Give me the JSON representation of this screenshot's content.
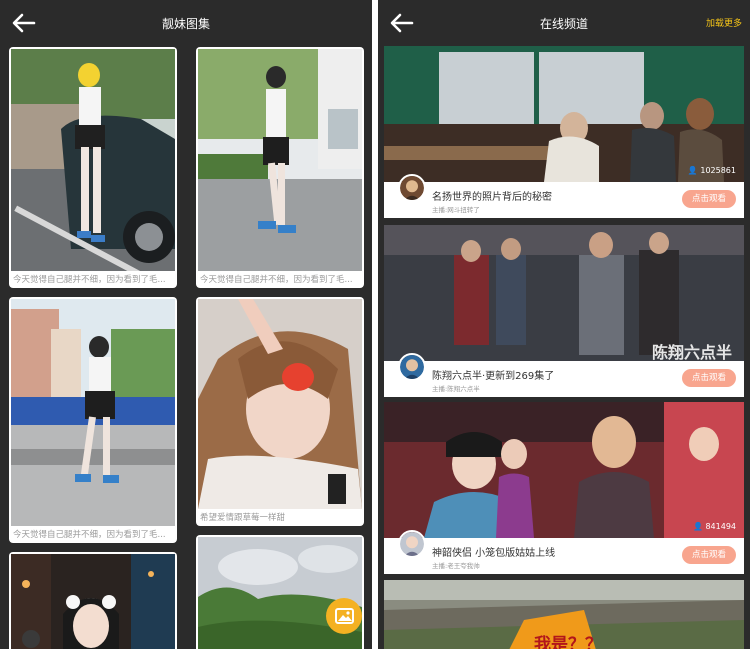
{
  "left_screen": {
    "title": "靓妹图集",
    "back_icon": "back-arrow-icon",
    "cards": [
      {
        "caption": "今天觉得自己腿并不细，因为看到了毛..."
      },
      {
        "caption": "今天觉得自己腿并不细，因为看到了毛..."
      },
      {
        "caption": "今天觉得自己腿并不细，因为看到了毛..."
      },
      {
        "caption": "希望爱情跟草莓一样甜"
      },
      {
        "caption": ""
      },
      {
        "caption": ""
      }
    ],
    "fab_icon": "image-icon"
  },
  "right_screen": {
    "title": "在线频道",
    "load_more": "加载更多",
    "back_icon": "back-arrow-icon",
    "channels": [
      {
        "title": "名扬世界的照片背后的秘密",
        "host": "主播:网斗扭转了",
        "views": "1025861",
        "button": "点击观看"
      },
      {
        "title": "陈翔六点半·更新到269集了",
        "host": "主播:陈翔六点半",
        "views": "",
        "overlay_text": "陈翔六点半",
        "button": "点击观看"
      },
      {
        "title": "神韶侠侣 小笼包版姑姑上线",
        "host": "主播:老王夸我帅",
        "views": "841494",
        "button": "点击观看"
      },
      {
        "title": "",
        "host": "",
        "views": "",
        "overlay_text": "我是？？",
        "button": ""
      }
    ]
  },
  "colors": {
    "background": "#2b2b2b",
    "accent_yellow": "#f5c518",
    "button_pink": "#f8a58e",
    "fab_orange": "#f4b122"
  }
}
